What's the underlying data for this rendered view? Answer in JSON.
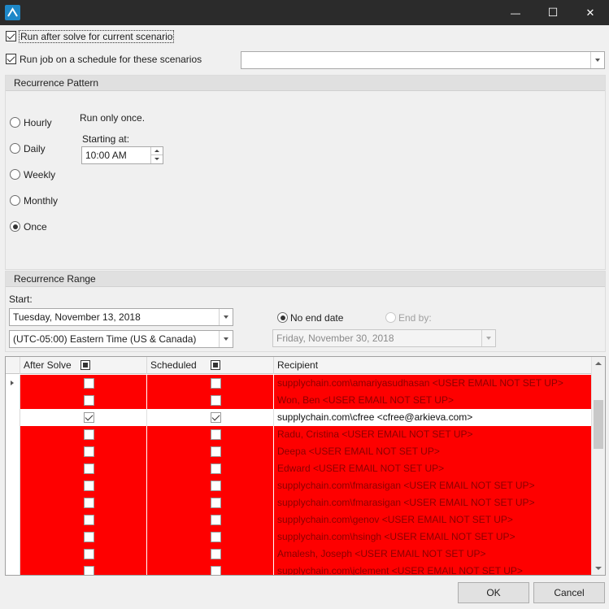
{
  "window": {
    "minimize_glyph": "—",
    "maximize_glyph": "☐",
    "close_glyph": "✕"
  },
  "options": {
    "run_after_solve": {
      "label": "Run after solve for current scenario",
      "checked": true
    },
    "run_on_schedule": {
      "label": "Run job on a schedule for these scenarios",
      "checked": true
    },
    "scenario_combo_value": ""
  },
  "recurrence_pattern": {
    "title": "Recurrence Pattern",
    "options": [
      "Hourly",
      "Daily",
      "Weekly",
      "Monthly",
      "Once"
    ],
    "selected": "Once",
    "description": "Run only once.",
    "starting_at_label": "Starting at:",
    "starting_at_value": "10:00 AM"
  },
  "recurrence_range": {
    "title": "Recurrence Range",
    "start_label": "Start:",
    "start_date": "Tuesday, November 13, 2018",
    "timezone": "(UTC-05:00) Eastern Time (US & Canada)",
    "no_end_date_label": "No end date",
    "end_by_label": "End by:",
    "end_by_date": "Friday, November 30, 2018",
    "selected": "No end date"
  },
  "grid": {
    "columns": [
      "After Solve",
      "Scheduled",
      "Recipient"
    ],
    "rows": [
      {
        "after_solve": false,
        "scheduled": false,
        "recipient": "supplychain.com\\amariyasudhasan <USER EMAIL NOT SET UP>",
        "status": "error"
      },
      {
        "after_solve": false,
        "scheduled": false,
        "recipient": "Won, Ben <USER EMAIL NOT SET UP>",
        "status": "error"
      },
      {
        "after_solve": true,
        "scheduled": true,
        "recipient": "supplychain.com\\cfree <cfree@arkieva.com>",
        "status": "ok"
      },
      {
        "after_solve": false,
        "scheduled": false,
        "recipient": "Radu, Cristina <USER EMAIL NOT SET UP>",
        "status": "error"
      },
      {
        "after_solve": false,
        "scheduled": false,
        "recipient": "Deepa <USER EMAIL NOT SET UP>",
        "status": "error"
      },
      {
        "after_solve": false,
        "scheduled": false,
        "recipient": "Edward <USER EMAIL NOT SET UP>",
        "status": "error"
      },
      {
        "after_solve": false,
        "scheduled": false,
        "recipient": "supplychain.com\\fmarasigan <USER EMAIL NOT SET UP>",
        "status": "error"
      },
      {
        "after_solve": false,
        "scheduled": false,
        "recipient": "supplychain.com\\fmarasigan <USER EMAIL NOT SET UP>",
        "status": "error"
      },
      {
        "after_solve": false,
        "scheduled": false,
        "recipient": "supplychain.com\\genov <USER EMAIL NOT SET UP>",
        "status": "error"
      },
      {
        "after_solve": false,
        "scheduled": false,
        "recipient": "supplychain.com\\hsingh <USER EMAIL NOT SET UP>",
        "status": "error"
      },
      {
        "after_solve": false,
        "scheduled": false,
        "recipient": "Amalesh, Joseph <USER EMAIL NOT SET UP>",
        "status": "error"
      },
      {
        "after_solve": false,
        "scheduled": false,
        "recipient": "supplychain.com\\jclement <USER EMAIL NOT SET UP>",
        "status": "error"
      }
    ]
  },
  "buttons": {
    "ok": "OK",
    "cancel": "Cancel"
  },
  "colors": {
    "error_row": "#fe0000",
    "titlebar": "#2b2b2b",
    "accent": "#1e88c8"
  }
}
